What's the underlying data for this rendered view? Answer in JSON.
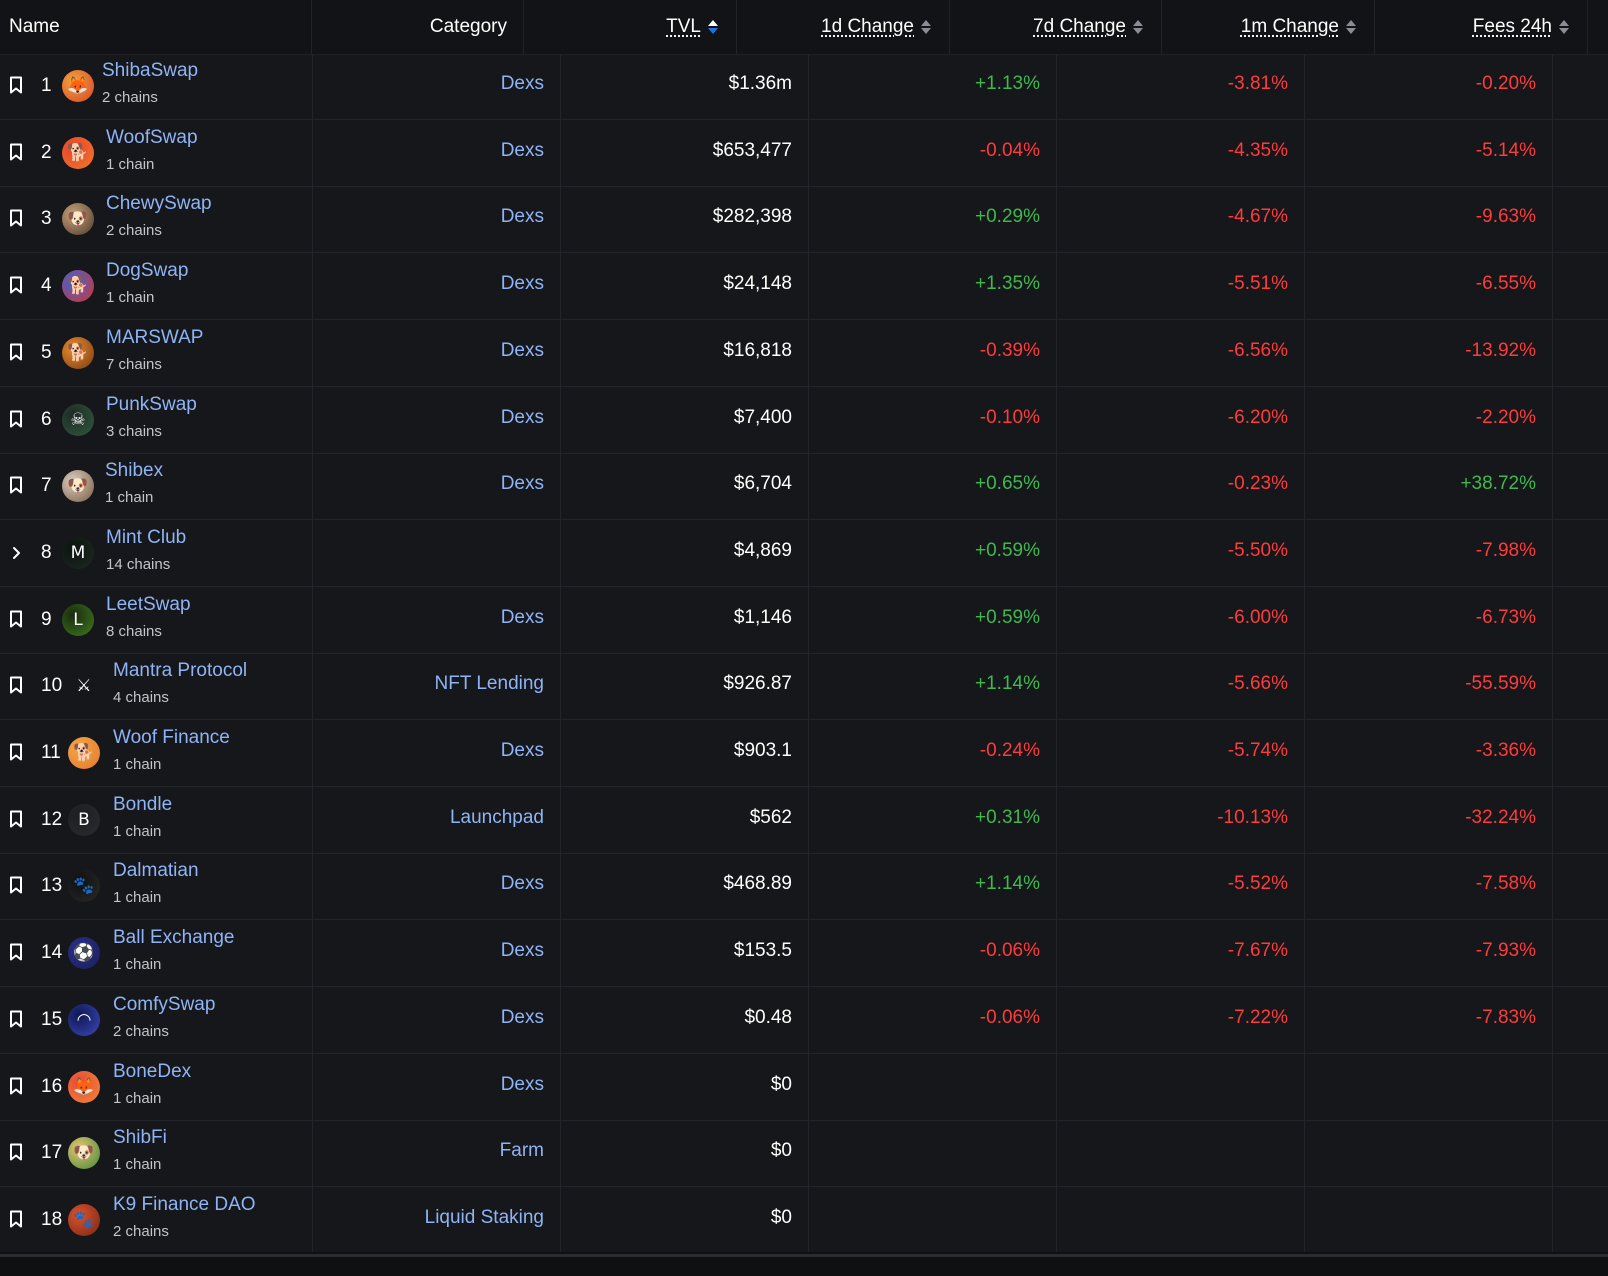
{
  "header": {
    "name": "Name",
    "category": "Category",
    "tvl": "TVL",
    "change_1d": "1d Change",
    "change_7d": "7d Change",
    "change_1m": "1m Change",
    "fees_24h": "Fees 24h"
  },
  "colors": {
    "background": "#16171a",
    "header_background": "#121316",
    "link": "#8fb4f5",
    "positive": "#3fb84f",
    "negative": "#fd3c3c",
    "sort_active": "#2172e5"
  },
  "rows": [
    {
      "rank": "1",
      "name": "ShibaSwap",
      "chains": "2 chains",
      "category": "Dexs",
      "tvl": "$1.36m",
      "change_1d": "+1.13%",
      "change_7d": "-3.81%",
      "fees": "-0.20%",
      "icon": "shiba-logo-icon",
      "row_icon": "bookmark-icon"
    },
    {
      "rank": "2",
      "name": "WoofSwap",
      "chains": "1 chain",
      "category": "Dexs",
      "tvl": "$653,477",
      "change_1d": "-0.04%",
      "change_7d": "-4.35%",
      "fees": "-5.14%",
      "icon": "woof-logo-icon",
      "row_icon": "bookmark-icon"
    },
    {
      "rank": "3",
      "name": "ChewySwap",
      "chains": "2 chains",
      "category": "Dexs",
      "tvl": "$282,398",
      "change_1d": "+0.29%",
      "change_7d": "-4.67%",
      "fees": "-9.63%",
      "icon": "chewy-logo-icon",
      "row_icon": "bookmark-icon"
    },
    {
      "rank": "4",
      "name": "DogSwap",
      "chains": "1 chain",
      "category": "Dexs",
      "tvl": "$24,148",
      "change_1d": "+1.35%",
      "change_7d": "-5.51%",
      "fees": "-6.55%",
      "icon": "dogswap-logo-icon",
      "row_icon": "bookmark-icon"
    },
    {
      "rank": "5",
      "name": "MARSWAP",
      "chains": "7 chains",
      "category": "Dexs",
      "tvl": "$16,818",
      "change_1d": "-0.39%",
      "change_7d": "-6.56%",
      "fees": "-13.92%",
      "icon": "marswap-logo-icon",
      "row_icon": "bookmark-icon"
    },
    {
      "rank": "6",
      "name": "PunkSwap",
      "chains": "3 chains",
      "category": "Dexs",
      "tvl": "$7,400",
      "change_1d": "-0.10%",
      "change_7d": "-6.20%",
      "fees": "-2.20%",
      "icon": "punkswap-logo-icon",
      "row_icon": "bookmark-icon"
    },
    {
      "rank": "7",
      "name": "Shibex",
      "chains": "1 chain",
      "category": "Dexs",
      "tvl": "$6,704",
      "change_1d": "+0.65%",
      "change_7d": "-0.23%",
      "fees": "+38.72%",
      "icon": "shibex-logo-icon",
      "row_icon": "bookmark-icon"
    },
    {
      "rank": "8",
      "name": "Mint Club",
      "chains": "14 chains",
      "category": "",
      "tvl": "$4,869",
      "change_1d": "+0.59%",
      "change_7d": "-5.50%",
      "fees": "-7.98%",
      "icon": "mintclub-logo-icon",
      "row_icon": "chevron-right-icon"
    },
    {
      "rank": "9",
      "name": "LeetSwap",
      "chains": "8 chains",
      "category": "Dexs",
      "tvl": "$1,146",
      "change_1d": "+0.59%",
      "change_7d": "-6.00%",
      "fees": "-6.73%",
      "icon": "leetswap-logo-icon",
      "row_icon": "bookmark-icon"
    },
    {
      "rank": "10",
      "name": "Mantra Protocol",
      "chains": "4 chains",
      "category": "NFT Lending",
      "tvl": "$926.87",
      "change_1d": "+1.14%",
      "change_7d": "-5.66%",
      "fees": "-55.59%",
      "icon": "mantra-logo-icon",
      "row_icon": "bookmark-icon"
    },
    {
      "rank": "11",
      "name": "Woof Finance",
      "chains": "1 chain",
      "category": "Dexs",
      "tvl": "$903.1",
      "change_1d": "-0.24%",
      "change_7d": "-5.74%",
      "fees": "-3.36%",
      "icon": "wooffinance-logo-icon",
      "row_icon": "bookmark-icon"
    },
    {
      "rank": "12",
      "name": "Bondle",
      "chains": "1 chain",
      "category": "Launchpad",
      "tvl": "$562",
      "change_1d": "+0.31%",
      "change_7d": "-10.13%",
      "fees": "-32.24%",
      "icon": "bondle-logo-icon",
      "row_icon": "bookmark-icon"
    },
    {
      "rank": "13",
      "name": "Dalmatian",
      "chains": "1 chain",
      "category": "Dexs",
      "tvl": "$468.89",
      "change_1d": "+1.14%",
      "change_7d": "-5.52%",
      "fees": "-7.58%",
      "icon": "dalmatian-logo-icon",
      "row_icon": "bookmark-icon"
    },
    {
      "rank": "14",
      "name": "Ball Exchange",
      "chains": "1 chain",
      "category": "Dexs",
      "tvl": "$153.5",
      "change_1d": "-0.06%",
      "change_7d": "-7.67%",
      "fees": "-7.93%",
      "icon": "ballexchange-logo-icon",
      "row_icon": "bookmark-icon"
    },
    {
      "rank": "15",
      "name": "ComfySwap",
      "chains": "2 chains",
      "category": "Dexs",
      "tvl": "$0.48",
      "change_1d": "-0.06%",
      "change_7d": "-7.22%",
      "fees": "-7.83%",
      "icon": "comfyswap-logo-icon",
      "row_icon": "bookmark-icon"
    },
    {
      "rank": "16",
      "name": "BoneDex",
      "chains": "1 chain",
      "category": "Dexs",
      "tvl": "$0",
      "change_1d": "",
      "change_7d": "",
      "fees": "",
      "icon": "bonedex-logo-icon",
      "row_icon": "bookmark-icon"
    },
    {
      "rank": "17",
      "name": "ShibFi",
      "chains": "1 chain",
      "category": "Farm",
      "tvl": "$0",
      "change_1d": "",
      "change_7d": "",
      "fees": "",
      "icon": "shibfi-logo-icon",
      "row_icon": "bookmark-icon"
    },
    {
      "rank": "18",
      "name": "K9 Finance DAO",
      "chains": "2 chains",
      "category": "Liquid Staking",
      "tvl": "$0",
      "change_1d": "",
      "change_7d": "",
      "fees": "",
      "icon": "k9finance-logo-icon",
      "row_icon": "bookmark-icon"
    }
  ]
}
